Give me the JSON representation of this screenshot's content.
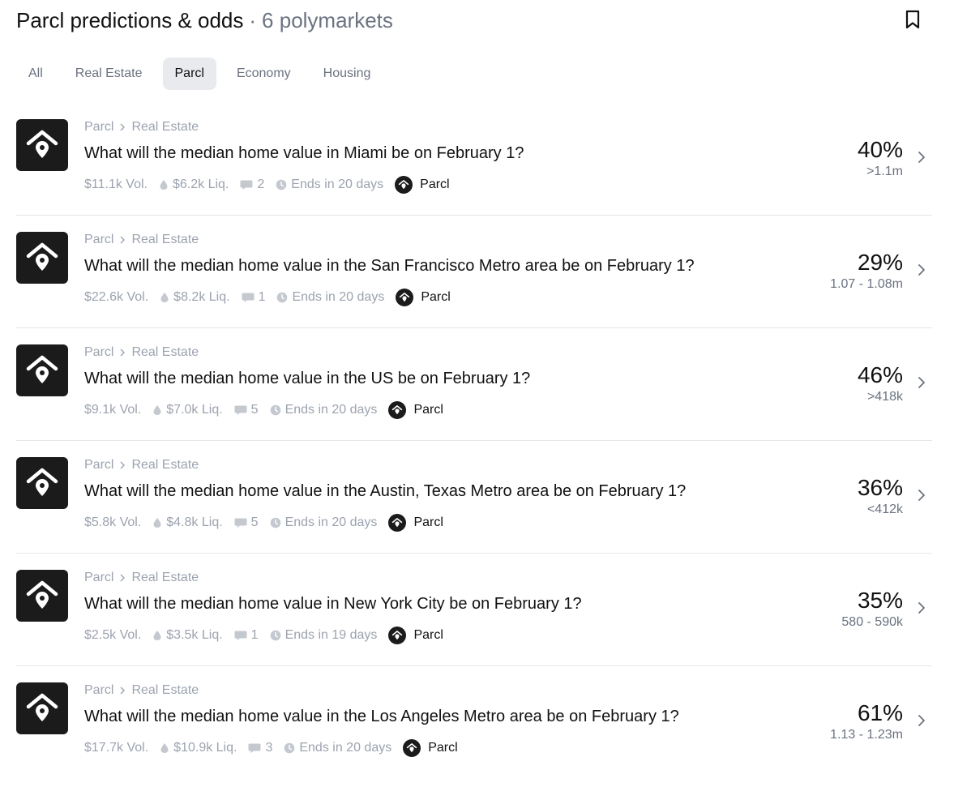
{
  "header": {
    "title": "Parcl predictions & odds",
    "dot": "·",
    "count": "6 polymarkets"
  },
  "tabs": [
    "All",
    "Real Estate",
    "Parcl",
    "Economy",
    "Housing"
  ],
  "active_tab": "Parcl",
  "markets": [
    {
      "crumb1": "Parcl",
      "crumb2": "Real Estate",
      "question": "What will the median home value in Miami be on February 1?",
      "vol": "$11.1k Vol.",
      "liq": "$6.2k Liq.",
      "comments": "2",
      "ends": "Ends in 20 days",
      "tag": "Parcl",
      "pct": "40%",
      "outcome": ">1.1m"
    },
    {
      "crumb1": "Parcl",
      "crumb2": "Real Estate",
      "question": "What will the median home value in the San Francisco Metro area be on February 1?",
      "vol": "$22.6k Vol.",
      "liq": "$8.2k Liq.",
      "comments": "1",
      "ends": "Ends in 20 days",
      "tag": "Parcl",
      "pct": "29%",
      "outcome": "1.07 - 1.08m"
    },
    {
      "crumb1": "Parcl",
      "crumb2": "Real Estate",
      "question": "What will the median home value in the US be on February 1?",
      "vol": "$9.1k Vol.",
      "liq": "$7.0k Liq.",
      "comments": "5",
      "ends": "Ends in 20 days",
      "tag": "Parcl",
      "pct": "46%",
      "outcome": ">418k"
    },
    {
      "crumb1": "Parcl",
      "crumb2": "Real Estate",
      "question": "What will the median home value in the Austin, Texas Metro area be on February 1?",
      "vol": "$5.8k Vol.",
      "liq": "$4.8k Liq.",
      "comments": "5",
      "ends": "Ends in 20 days",
      "tag": "Parcl",
      "pct": "36%",
      "outcome": "<412k"
    },
    {
      "crumb1": "Parcl",
      "crumb2": "Real Estate",
      "question": "What will the median home value in New York City be on February 1?",
      "vol": "$2.5k Vol.",
      "liq": "$3.5k Liq.",
      "comments": "1",
      "ends": "Ends in 19 days",
      "tag": "Parcl",
      "pct": "35%",
      "outcome": "580 - 590k"
    },
    {
      "crumb1": "Parcl",
      "crumb2": "Real Estate",
      "question": "What will the median home value in the Los Angeles Metro area be on February 1?",
      "vol": "$17.7k Vol.",
      "liq": "$10.9k Liq.",
      "comments": "3",
      "ends": "Ends in 20 days",
      "tag": "Parcl",
      "pct": "61%",
      "outcome": "1.13 - 1.23m"
    }
  ],
  "icons": {
    "bookmark": "bookmark-icon",
    "logo": "parcl-logo-icon",
    "liquidity": "droplet-icon",
    "comments": "comment-icon",
    "ends": "clock-icon",
    "chevron": "chevron-right-icon"
  }
}
